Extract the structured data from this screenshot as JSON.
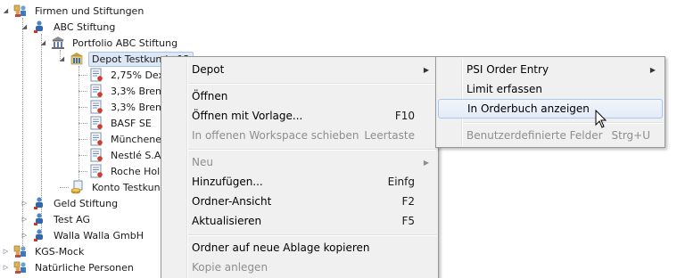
{
  "tree": {
    "items": [
      {
        "label": "Firmen und Stiftungen",
        "icon": "group-people-icon",
        "expander": "◢"
      },
      {
        "label": "ABC Stiftung",
        "icon": "foundation-person-icon",
        "expander": "◢"
      },
      {
        "label": "Portfolio ABC Stiftung",
        "icon": "portfolio-building-icon",
        "expander": "◢"
      },
      {
        "label": "Depot Testkunde 12",
        "icon": "depot-bank-icon",
        "expander": "◢"
      },
      {
        "label": "2,75% Dex",
        "icon": "security-document-icon"
      },
      {
        "label": "3,3% Brem.",
        "icon": "security-document-icon"
      },
      {
        "label": "3,3% Brem.",
        "icon": "security-document-icon"
      },
      {
        "label": "BASF SE",
        "icon": "security-document-icon"
      },
      {
        "label": "Münchener",
        "icon": "security-document-icon"
      },
      {
        "label": "Nestlé S.A.",
        "icon": "security-document-icon"
      },
      {
        "label": "Roche Holdi",
        "icon": "security-document-icon"
      },
      {
        "label": "Konto Testkunde",
        "icon": "account-coins-icon"
      },
      {
        "label": "Geld Stiftung",
        "icon": "foundation-person-icon",
        "expander": "▷"
      },
      {
        "label": "Test AG",
        "icon": "foundation-person-icon",
        "expander": "▷"
      },
      {
        "label": "Walla Walla GmbH",
        "icon": "foundation-person-icon",
        "expander": "▷"
      },
      {
        "label": "KGS-Mock",
        "icon": "group-people-icon",
        "expander": "▷"
      },
      {
        "label": "Natürliche Personen",
        "icon": "group-people-icon",
        "expander": "▷"
      }
    ]
  },
  "context_menu": {
    "items": [
      {
        "label": "Depot",
        "submenu": true
      },
      {
        "label": "Öffnen"
      },
      {
        "label": "Öffnen mit Vorlage...",
        "shortcut": "F10"
      },
      {
        "label": "In offenen Workspace schieben",
        "shortcut": "Leertaste",
        "disabled": true
      },
      {
        "label": "Neu",
        "submenu": true,
        "disabled": true
      },
      {
        "label": "Hinzufügen...",
        "shortcut": "Einfg"
      },
      {
        "label": "Ordner-Ansicht",
        "shortcut": "F2"
      },
      {
        "label": "Aktualisieren",
        "shortcut": "F5"
      },
      {
        "label": "Ordner auf neue Ablage kopieren"
      },
      {
        "label": "Kopie anlegen",
        "disabled": true
      }
    ]
  },
  "submenu": {
    "items": [
      {
        "label": "PSI Order Entry",
        "submenu": true
      },
      {
        "label": "Limit erfassen"
      },
      {
        "label": "In Orderbuch anzeigen",
        "highlighted": true
      },
      {
        "label": "Benutzerdefinierte Felder",
        "shortcut": "Strg+U",
        "disabled": true
      }
    ]
  },
  "colors": {
    "menu_bg": "#f0f0f0",
    "menu_border": "#979797",
    "highlight_border": "#a8c8ec",
    "selected_node_bg": "#dde8f6",
    "disabled_text": "#8e8e8e"
  }
}
